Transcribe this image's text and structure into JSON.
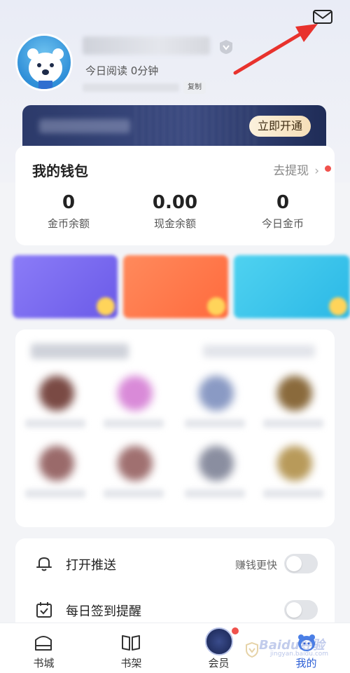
{
  "profile": {
    "read_time": "今日阅读 0分钟",
    "copy_label": "复制"
  },
  "vip_banner": {
    "button_label": "立即开通"
  },
  "wallet": {
    "title": "我的钱包",
    "withdraw_label": "去提现",
    "withdraw_chevron": "›",
    "stats": [
      {
        "value": "0",
        "label": "金币余额"
      },
      {
        "value": "0.00",
        "label": "现金余额"
      },
      {
        "value": "0",
        "label": "今日金币"
      }
    ]
  },
  "promo_colors": [
    "#7a6cf2",
    "#ff7a4d",
    "#3cc6ea"
  ],
  "settings": [
    {
      "label": "打开推送",
      "hint": "赚钱更快",
      "icon": "bell-icon",
      "enabled": false
    },
    {
      "label": "每日签到提醒",
      "hint": "",
      "icon": "calendar-check-icon",
      "enabled": false
    }
  ],
  "tabbar": {
    "tabs": [
      {
        "label": "书城",
        "icon": "bookstore-icon",
        "active": false
      },
      {
        "label": "书架",
        "icon": "bookshelf-icon",
        "active": false
      },
      {
        "label": "会员",
        "icon": "vip-shield-icon",
        "active": false
      },
      {
        "label": "我的",
        "icon": "bear-profile-icon",
        "active": true
      }
    ]
  },
  "watermark": {
    "text": "Baidu经验",
    "sub": "jingyan.baidu.com"
  },
  "colors": {
    "accent_blue": "#2c5fd6",
    "red_dot": "#f0524d",
    "vip_dark": "#2c3a6a",
    "vip_gold": "#f6dfb8"
  }
}
